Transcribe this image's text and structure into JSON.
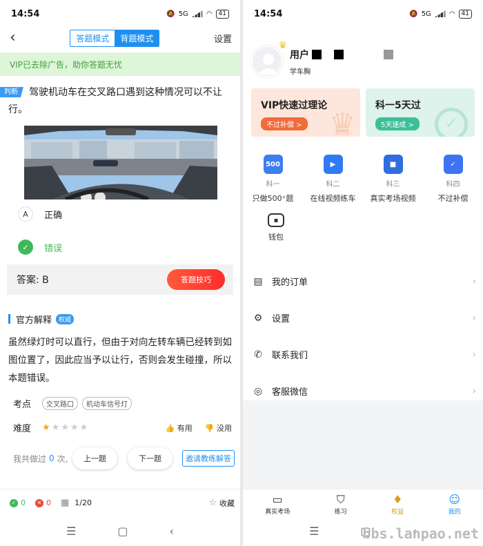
{
  "status": {
    "time": "14:54",
    "battery": "41",
    "network": "5G"
  },
  "left": {
    "modes": [
      "答题模式",
      "背题模式"
    ],
    "settings": "设置",
    "vip_banner": "VIP已去除广告，助你答题无忧",
    "question_tag": "判断",
    "question": "驾驶机动车在交叉路口遇到这种情况可以不让行。",
    "options": [
      {
        "letter": "A",
        "text": "正确"
      },
      {
        "letter": "✓",
        "text": "错误"
      }
    ],
    "answer": "答案: B",
    "tips_button": "答题技巧",
    "section_title": "官方解释",
    "section_badge": "权威",
    "explanation": "虽然绿灯时可以直行，但由于对向左转车辆已经转到如图位置了，因此应当予以让行，否则会发生碰撞，所以本题错误。",
    "kp_label": "考点",
    "kp_tags": [
      "交叉路口",
      "机动车信号灯"
    ],
    "difficulty_label": "难度",
    "useful": "有用",
    "useless": "没用",
    "done_prefix": "我共做过",
    "done_count": "0",
    "done_suffix": "次,",
    "prev": "上一题",
    "next": "下一题",
    "invite": "邀请教练解答",
    "correct": "0",
    "wrong": "0",
    "progress": "1/20",
    "favorite": "收藏"
  },
  "right": {
    "username": "用户",
    "subtitle": "学车胸",
    "cards": [
      {
        "title": "VIP快速过理论",
        "badge": "不过补偿 >"
      },
      {
        "title": "科一5天过",
        "badge": "5天速成 >"
      }
    ],
    "grid": [
      {
        "icon": "500",
        "sub": "科一",
        "label": "只做500⁺题"
      },
      {
        "icon": "▶",
        "sub": "科二",
        "label": "在线视频练车"
      },
      {
        "icon": "■",
        "sub": "科三",
        "label": "真实考场视频"
      },
      {
        "icon": "✓",
        "sub": "科四",
        "label": "不过补偿"
      }
    ],
    "wallet": "钱包",
    "menu": [
      "我的订单",
      "设置",
      "联系我们",
      "客服微信"
    ],
    "tabs": [
      "真实考场",
      "练习",
      "权益",
      "我的"
    ],
    "watermark": "bbs.lanpao.net"
  }
}
